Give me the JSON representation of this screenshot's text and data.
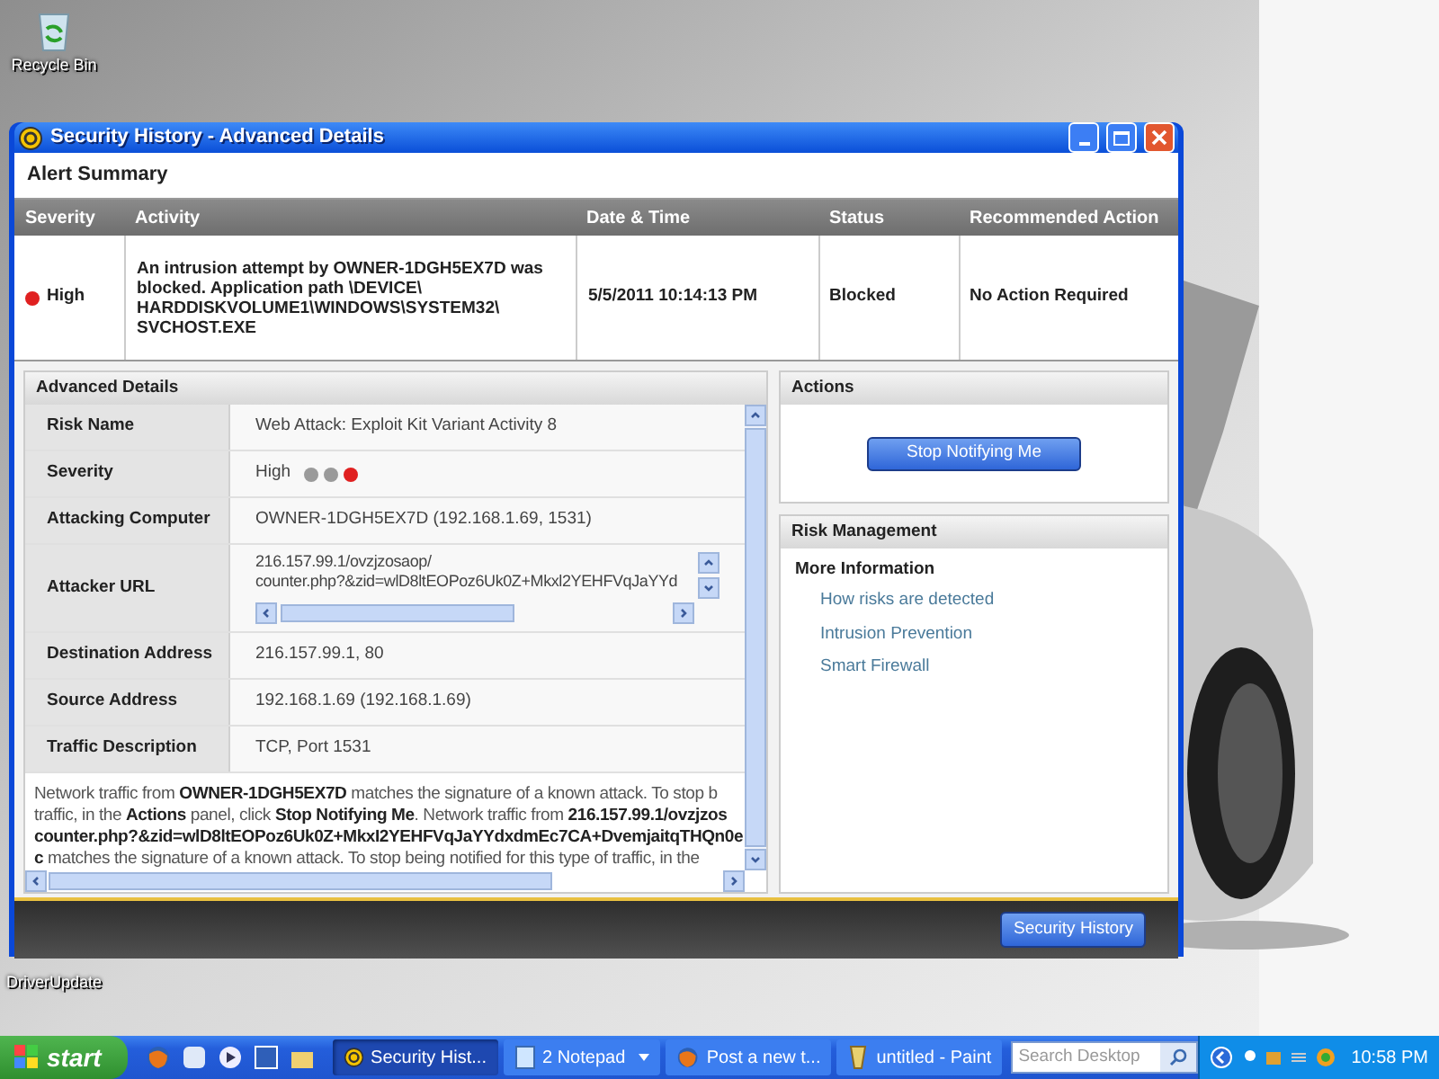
{
  "desktop_icons": [
    {
      "label": "Recycle Bin",
      "kind": "recycle"
    },
    {
      "label": "DriverUpdate",
      "kind": "app"
    }
  ],
  "window": {
    "title": "Security History - Advanced Details",
    "section_title": "Alert Summary",
    "columns": [
      "Severity",
      "Activity",
      "Date & Time",
      "Status",
      "Recommended Action"
    ],
    "rows": [
      {
        "severity": "High",
        "color": "#e02020",
        "activity": "An intrusion attempt by OWNER-1DGH5EX7D was blocked. Application path \\DEVICE\\ HARDDISKVOLUME1\\WINDOWS\\SYSTEM32\\ SVCHOST.EXE",
        "date_time": "5/5/2011 10:14:13 PM",
        "status": "Blocked",
        "recommended_action": "No Action Required"
      }
    ],
    "advanced_details": {
      "title": "Advanced Details",
      "rows": [
        {
          "kind": "text",
          "label": "Risk Name",
          "value": "Web Attack: Exploit Kit Variant Activity 8"
        },
        {
          "kind": "severity",
          "label": "Severity",
          "value": "High",
          "dots": [
            {
              "color": "#9a9a9a"
            },
            {
              "color": "#9a9a9a"
            },
            {
              "color": "#e02020"
            }
          ]
        },
        {
          "kind": "text",
          "label": "Attacking Computer",
          "value": "OWNER-1DGH5EX7D (192.168.1.69, 1531)"
        },
        {
          "kind": "scroll",
          "label": "Attacker URL",
          "lines": [
            "216.157.99.1/ovzjzosaop/",
            "counter.php?&zid=wlD8ltEOPoz6Uk0Z+Mkxl2YEHFVqJaYYd"
          ]
        },
        {
          "kind": "text",
          "label": "Destination Address",
          "value": "216.157.99.1, 80"
        },
        {
          "kind": "text",
          "label": "Source Address",
          "value": "192.168.1.69 (192.168.1.69)"
        },
        {
          "kind": "text",
          "label": "Traffic Description",
          "value": "TCP, Port 1531"
        }
      ],
      "description": [
        "Network traffic from **OWNER-1DGH5EX7D** matches the signature of a known attack. To stop b",
        "traffic, in the **Actions** panel, click **Stop Notifying Me**. Network traffic from **216.157.99.1/ovzjzos**",
        "**counter.php?&zid=wlD8ltEOPoz6Uk0Z+MkxI2YEHFVqJaYYdxdmEc7CA+DvemjaitqTHQn0e**",
        "**c** matches the signature of a known attack. To stop being notified for this type of traffic, in the"
      ]
    },
    "actions": {
      "title": "Actions",
      "button": "Stop Notifying Me"
    },
    "risk_management": {
      "title": "Risk Management",
      "subtitle": "More Information",
      "links": [
        "How risks are detected",
        "Intrusion Prevention",
        "Smart Firewall"
      ]
    },
    "footer_button": "Security History"
  },
  "taskbar": {
    "start": "start",
    "tasks": [
      {
        "label": "Security Hist...",
        "selected": true,
        "kind": "shield"
      },
      {
        "label": "2 Notepad",
        "selected": false,
        "kind": "notepad",
        "menu": true
      },
      {
        "label": "Post a new t...",
        "selected": false,
        "kind": "browser"
      },
      {
        "label": "untitled - Paint",
        "selected": false,
        "kind": "paint"
      }
    ],
    "search": {
      "placeholder": "Search Desktop"
    },
    "clock": "10:58 PM"
  }
}
